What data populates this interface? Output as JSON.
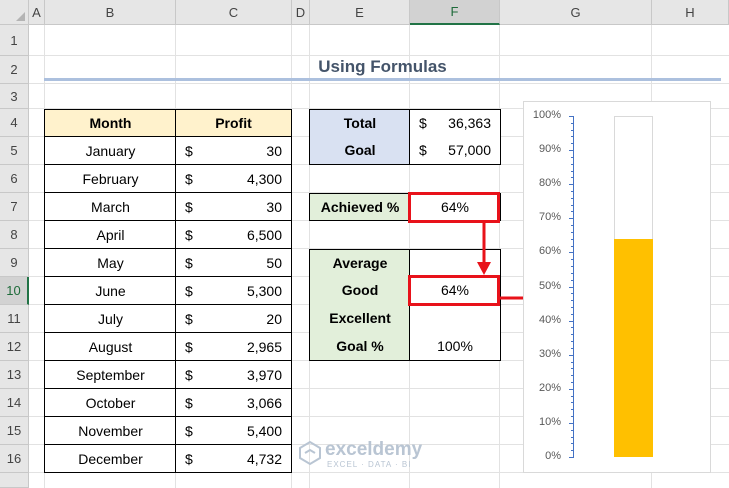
{
  "columns": [
    "A",
    "B",
    "C",
    "D",
    "E",
    "F",
    "G",
    "H"
  ],
  "rows": [
    "1",
    "2",
    "3",
    "4",
    "5",
    "6",
    "7",
    "8",
    "9",
    "10",
    "11",
    "12",
    "13",
    "14",
    "15",
    "16"
  ],
  "title": "Using Formulas",
  "table": {
    "headers": [
      "Month",
      "Profit"
    ],
    "currency": "$",
    "rows": [
      {
        "month": "January",
        "profit": "30"
      },
      {
        "month": "February",
        "profit": "4,300"
      },
      {
        "month": "March",
        "profit": "30"
      },
      {
        "month": "April",
        "profit": "6,500"
      },
      {
        "month": "May",
        "profit": "50"
      },
      {
        "month": "June",
        "profit": "5,300"
      },
      {
        "month": "July",
        "profit": "20"
      },
      {
        "month": "August",
        "profit": "2,965"
      },
      {
        "month": "September",
        "profit": "3,970"
      },
      {
        "month": "October",
        "profit": "3,066"
      },
      {
        "month": "November",
        "profit": "5,400"
      },
      {
        "month": "December",
        "profit": "4,732"
      }
    ]
  },
  "summary": {
    "total_label": "Total",
    "total_currency": "$",
    "total_value": "36,363",
    "goal_label": "Goal",
    "goal_currency": "$",
    "goal_value": "57,000"
  },
  "achieved": {
    "label": "Achieved %",
    "value": "64%"
  },
  "levels": {
    "average_label": "Average",
    "average_value": "",
    "good_label": "Good",
    "good_value": "64%",
    "excellent_label": "Excellent",
    "excellent_value": "",
    "goalpct_label": "Goal %",
    "goalpct_value": "100%"
  },
  "chart_data": {
    "type": "bar",
    "categories": [
      ""
    ],
    "series": [
      {
        "values": [
          0.64
        ],
        "color": "#ffc000"
      },
      {
        "values": [
          1.0
        ],
        "color": "#ffffff"
      }
    ],
    "ylim": [
      0,
      1
    ],
    "yticks": [
      "0%",
      "10%",
      "20%",
      "30%",
      "40%",
      "50%",
      "60%",
      "70%",
      "80%",
      "90%",
      "100%"
    ],
    "grid": false,
    "legend": "none"
  },
  "colors": {
    "header_yellow": "#fff2cc",
    "header_blue": "#d9e1f2",
    "header_green": "#e2efda",
    "highlight_red": "#e8121a",
    "bar_fill": "#ffc000",
    "axis_blue": "#4472c4"
  },
  "watermark": {
    "brand": "exceldemy",
    "tagline": "EXCEL · DATA · BI"
  }
}
